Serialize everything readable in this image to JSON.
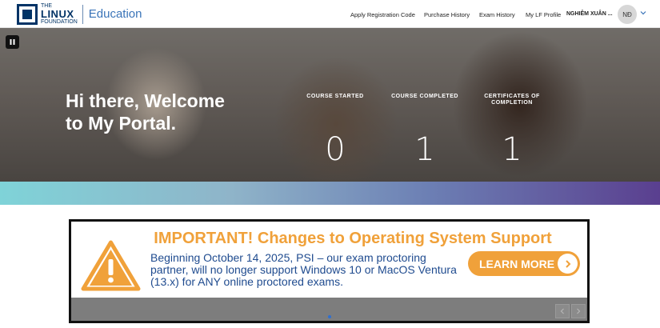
{
  "header": {
    "logo": {
      "line1": "THE",
      "line2": "LINUX",
      "line3": "FOUNDATION",
      "product": "Education"
    },
    "nav": [
      {
        "label": "Apply Registration Code"
      },
      {
        "label": "Purchase History"
      },
      {
        "label": "Exam History"
      },
      {
        "label": "My LF Profile"
      }
    ],
    "user_name": "NGHIÊM XUÂN ...",
    "avatar_initials": "NĐ"
  },
  "hero": {
    "title": "Hi there, Welcome to My Portal.",
    "stats": [
      {
        "label": "COURSE STARTED",
        "value": "0"
      },
      {
        "label": "COURSE COMPLETED",
        "value": "1"
      },
      {
        "label": "CERTIFICATES OF COMPLETION",
        "value": "1"
      }
    ]
  },
  "banner": {
    "headline": "IMPORTANT! Changes to Operating System Support",
    "body": "Beginning October 14, 2025, PSI – our exam proctoring partner, will no longer support Windows 10 or MacOS Ventura (13.x) for ANY online proctored exams.",
    "cta_label": "LEARN MORE"
  },
  "colors": {
    "brand_navy": "#003366",
    "accent_orange": "#f0a13a",
    "body_blue": "#1f4b8f"
  }
}
